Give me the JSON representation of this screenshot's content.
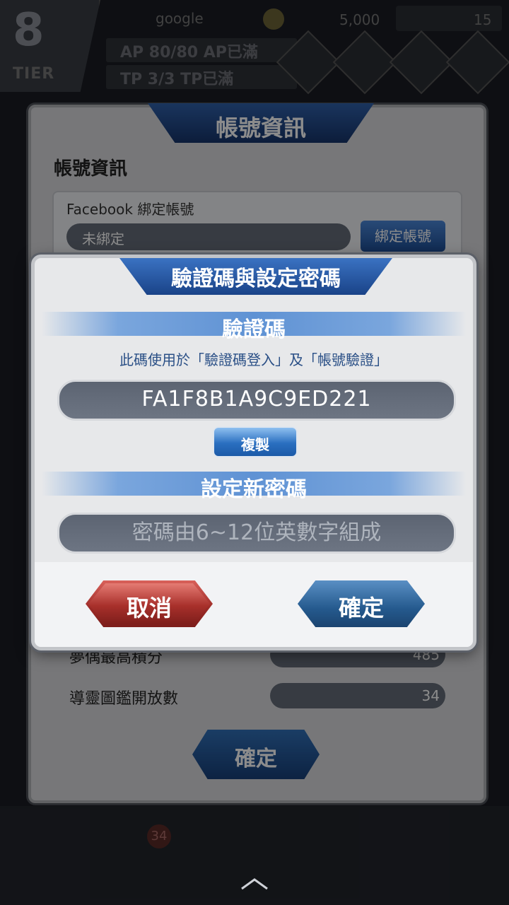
{
  "hud": {
    "tier_number": "8",
    "tier_label": "TIER",
    "player_name": "google",
    "coins": "5,000",
    "tickets": "15",
    "ap": "AP  80/80  AP已滿",
    "tp": "TP  3/3  TP已滿",
    "mail_badge": "34"
  },
  "account_panel": {
    "title": "帳號資訊",
    "section": "帳號資訊",
    "facebook_label": "Facebook 綁定帳號",
    "facebook_value": "未綁定",
    "bind_button": "綁定帳號",
    "stats": [
      {
        "label": "夢偶最高積分",
        "value": "485"
      },
      {
        "label": "導靈圖鑑開放數",
        "value": "34"
      }
    ],
    "ok_button": "確定"
  },
  "dialog": {
    "title": "驗證碼與設定密碼",
    "code_section": "驗證碼",
    "code_description": "此碼使用於「驗證碼登入」及「帳號驗證」",
    "code": "FA1F8B1A9C9ED221",
    "copy_button": "複製",
    "password_section": "設定新密碼",
    "password_placeholder": "密碼由6~12位英數字組成",
    "cancel_button": "取消",
    "confirm_button": "確定"
  }
}
